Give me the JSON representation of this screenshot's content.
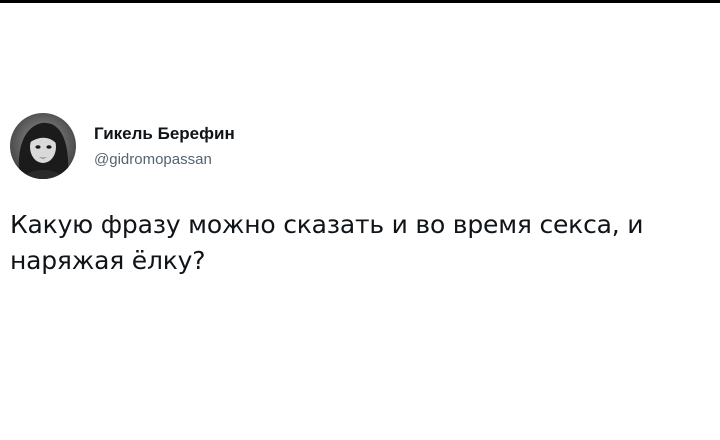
{
  "tweet": {
    "author": {
      "display_name": "Гикель Берефин",
      "handle": "@gidromopassan",
      "avatar_icon": "user-avatar-photo"
    },
    "text": "Какую фразу можно сказать и во время секса, и наряжая ёлку?"
  },
  "colors": {
    "background": "#ffffff",
    "text_primary": "#0f1419",
    "text_secondary": "#536471",
    "top_border": "#000000"
  }
}
